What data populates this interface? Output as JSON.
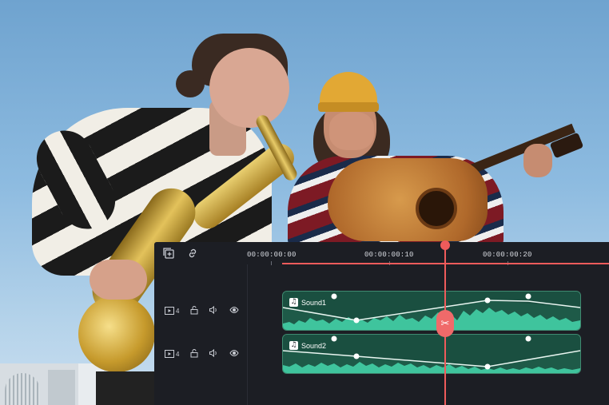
{
  "photo": {
    "subject": "two musicians",
    "colors": {
      "sky_top": "#6fa3cf",
      "sky_bottom": "#c9def0"
    }
  },
  "editor": {
    "toolbar": {
      "add_track_icon": "add-track-icon",
      "link_icon": "link-icon"
    },
    "ruler": {
      "ticks": [
        "00:00:00:00",
        "00:00:00:10",
        "00:00:00:20"
      ]
    },
    "playhead_position": "00:00:00:16",
    "tracks": [
      {
        "number": "4",
        "clip_name": "Sound1"
      },
      {
        "number": "4",
        "clip_name": "Sound2"
      }
    ],
    "cut_icon": "scissors-icon",
    "colors": {
      "panel": "#1c1e24",
      "clip": "#1e5a48",
      "waveform": "#3fc49d",
      "playhead": "#ef5b5b"
    }
  }
}
